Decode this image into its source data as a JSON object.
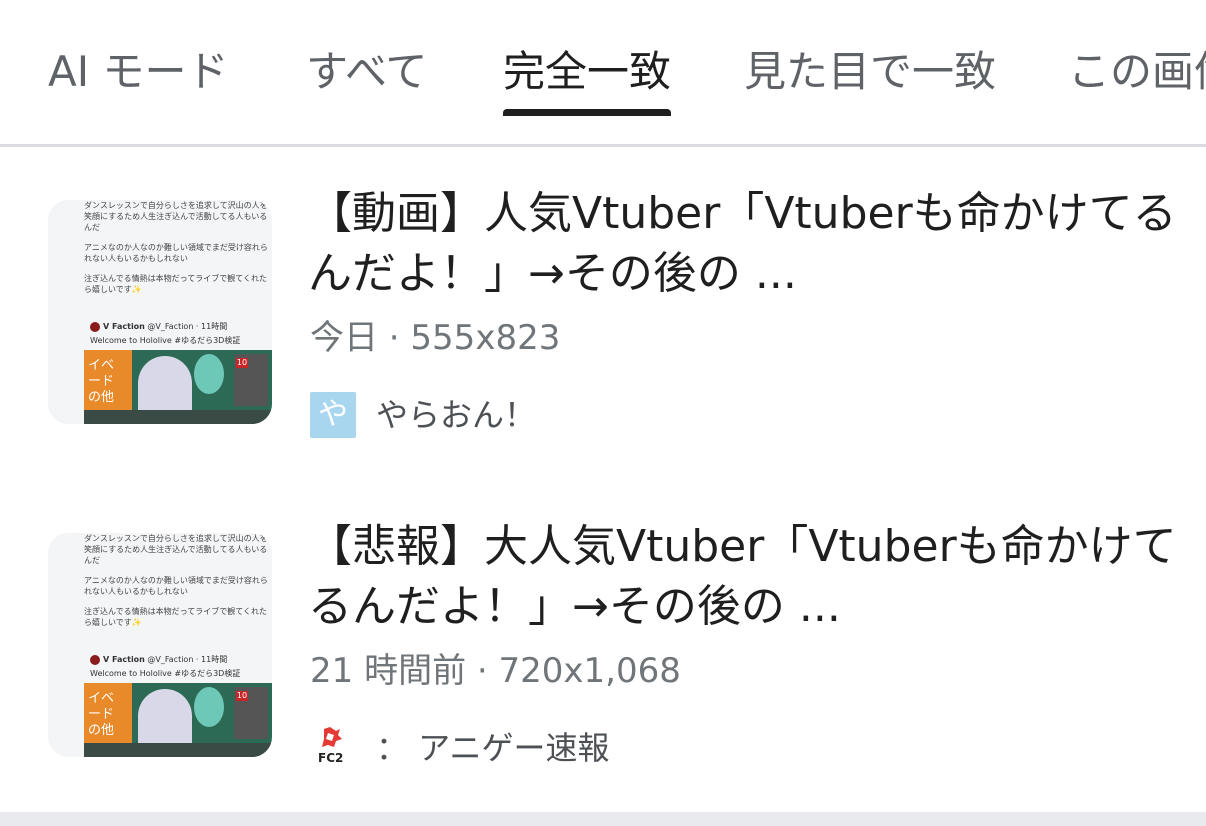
{
  "tabs": [
    {
      "label": "AI モード",
      "active": false
    },
    {
      "label": "すべて",
      "active": false
    },
    {
      "label": "完全一致",
      "active": true
    },
    {
      "label": "見た目で一致",
      "active": false
    },
    {
      "label": "この画像",
      "active": false
    }
  ],
  "results": [
    {
      "title": "【動画】人気Vtuber「Vtuberも命かけてるんだよ！」→その後の ...",
      "meta": "今日 · 555x823",
      "source": {
        "icon": "yaraon-icon",
        "icon_glyph": "や",
        "name": "やらおん！"
      },
      "thumbnail": {
        "lines": [
          "ダンスレッスンで自分らしさを追求して沢山の人を笑顔にするため人生注ぎ込んで活動してる人もいるんだ",
          "アニメなのか人なのか難しい領域でまだ受け容れられない人もいるかもしれない",
          "注ぎ込んでる情熱は本物だってライブで観てくれたら嬉しいです✨"
        ],
        "tweet_user": "V Faction",
        "tweet_handle": "@V_Faction · 11時間",
        "tweet_text": "Welcome to Hololive #ゆるだら3D検証",
        "art_text": "イベ\nード\nの他",
        "art_badge": "10"
      }
    },
    {
      "title": "【悲報】大人気Vtuber「Vtuberも命かけてるんだよ！」→その後の ...",
      "meta": "21 時間前 · 720x1,068",
      "source": {
        "icon": "fc2-icon",
        "icon_text": "FC2",
        "name": "： アニゲー速報"
      },
      "thumbnail": {
        "lines": [
          "ダンスレッスンで自分らしさを追求して沢山の人を笑顔にするため人生注ぎ込んで活動してる人もいるんだ",
          "アニメなのか人なのか難しい領域でまだ受け容れられない人もいるかもしれない",
          "注ぎ込んでる情熱は本物だってライブで観てくれたら嬉しいです✨"
        ],
        "tweet_user": "V Faction",
        "tweet_handle": "@V_Faction · 11時間",
        "tweet_text": "Welcome to Hololive #ゆるだら3D検証",
        "art_text": "イベ\nード\nの他",
        "art_badge": "10"
      }
    }
  ]
}
